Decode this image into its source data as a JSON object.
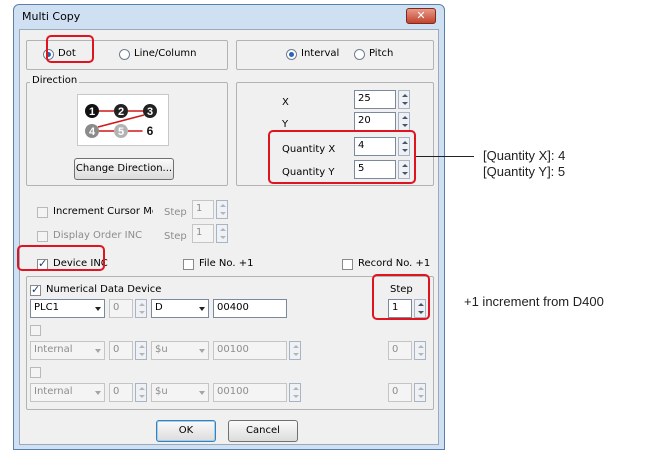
{
  "window": {
    "title": "Multi Copy",
    "close_glyph": "✕"
  },
  "mode": {
    "dot_label": "Dot",
    "line_column_label": "Line/Column",
    "selected": "Dot"
  },
  "spacing": {
    "interval_label": "Interval",
    "pitch_label": "Pitch",
    "selected": "Interval"
  },
  "direction": {
    "group_label": "Direction",
    "nodes": [
      "1",
      "2",
      "3",
      "4",
      "5",
      "6"
    ],
    "change_button": "Change Direction..."
  },
  "params": {
    "x_label": "X",
    "x_value": "25",
    "y_label": "Y",
    "y_value": "20",
    "qty_x_label": "Quantity X",
    "qty_x_value": "4",
    "qty_y_label": "Quantity Y",
    "qty_y_value": "5"
  },
  "options": {
    "increment_cursor_label": "Increment Cursor Mo",
    "increment_cursor_step_label": "Step",
    "increment_cursor_step_value": "1",
    "display_order_label": "Display Order INC",
    "display_order_step_label": "Step",
    "display_order_step_value": "1",
    "device_inc_label": "Device INC",
    "file_no_label": "File No. +1",
    "record_no_label": "Record No. +1"
  },
  "numerical": {
    "group_label": "Numerical Data Device",
    "step_header": "Step",
    "rows": [
      {
        "device": "PLC1",
        "station": "0",
        "type": "D",
        "address": "00400",
        "step": "1"
      },
      {
        "device": "Internal",
        "station": "0",
        "type": "$u",
        "address": "00100",
        "step": "0"
      },
      {
        "device": "Internal",
        "station": "0",
        "type": "$u",
        "address": "00100",
        "step": "0"
      }
    ]
  },
  "buttons": {
    "ok": "OK",
    "cancel": "Cancel"
  },
  "annotations": {
    "quantity_x": "[Quantity X]: 4",
    "quantity_y": "[Quantity Y]: 5",
    "increment": "+1 increment from D400"
  },
  "colors": {
    "highlight": "#e0141e",
    "dialog_frame": "#cfe0f3",
    "client_bg": "#f0f0f0"
  }
}
